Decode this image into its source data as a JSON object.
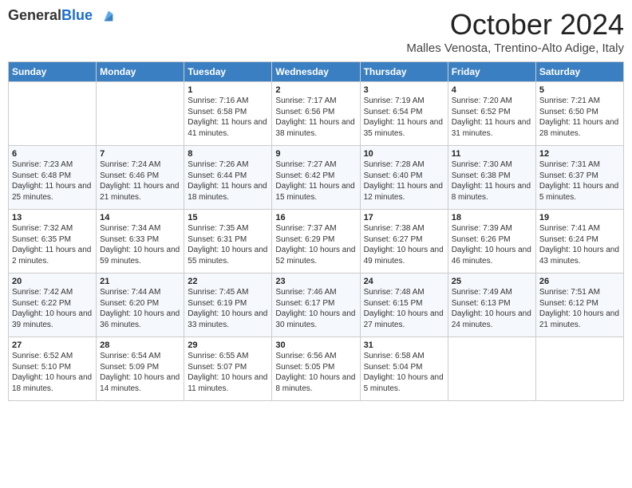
{
  "header": {
    "logo_general": "General",
    "logo_blue": "Blue",
    "month_title": "October 2024",
    "subtitle": "Malles Venosta, Trentino-Alto Adige, Italy"
  },
  "days_of_week": [
    "Sunday",
    "Monday",
    "Tuesday",
    "Wednesday",
    "Thursday",
    "Friday",
    "Saturday"
  ],
  "weeks": [
    [
      {
        "day": "",
        "info": ""
      },
      {
        "day": "",
        "info": ""
      },
      {
        "day": "1",
        "info": "Sunrise: 7:16 AM\nSunset: 6:58 PM\nDaylight: 11 hours and 41 minutes."
      },
      {
        "day": "2",
        "info": "Sunrise: 7:17 AM\nSunset: 6:56 PM\nDaylight: 11 hours and 38 minutes."
      },
      {
        "day": "3",
        "info": "Sunrise: 7:19 AM\nSunset: 6:54 PM\nDaylight: 11 hours and 35 minutes."
      },
      {
        "day": "4",
        "info": "Sunrise: 7:20 AM\nSunset: 6:52 PM\nDaylight: 11 hours and 31 minutes."
      },
      {
        "day": "5",
        "info": "Sunrise: 7:21 AM\nSunset: 6:50 PM\nDaylight: 11 hours and 28 minutes."
      }
    ],
    [
      {
        "day": "6",
        "info": "Sunrise: 7:23 AM\nSunset: 6:48 PM\nDaylight: 11 hours and 25 minutes."
      },
      {
        "day": "7",
        "info": "Sunrise: 7:24 AM\nSunset: 6:46 PM\nDaylight: 11 hours and 21 minutes."
      },
      {
        "day": "8",
        "info": "Sunrise: 7:26 AM\nSunset: 6:44 PM\nDaylight: 11 hours and 18 minutes."
      },
      {
        "day": "9",
        "info": "Sunrise: 7:27 AM\nSunset: 6:42 PM\nDaylight: 11 hours and 15 minutes."
      },
      {
        "day": "10",
        "info": "Sunrise: 7:28 AM\nSunset: 6:40 PM\nDaylight: 11 hours and 12 minutes."
      },
      {
        "day": "11",
        "info": "Sunrise: 7:30 AM\nSunset: 6:38 PM\nDaylight: 11 hours and 8 minutes."
      },
      {
        "day": "12",
        "info": "Sunrise: 7:31 AM\nSunset: 6:37 PM\nDaylight: 11 hours and 5 minutes."
      }
    ],
    [
      {
        "day": "13",
        "info": "Sunrise: 7:32 AM\nSunset: 6:35 PM\nDaylight: 11 hours and 2 minutes."
      },
      {
        "day": "14",
        "info": "Sunrise: 7:34 AM\nSunset: 6:33 PM\nDaylight: 10 hours and 59 minutes."
      },
      {
        "day": "15",
        "info": "Sunrise: 7:35 AM\nSunset: 6:31 PM\nDaylight: 10 hours and 55 minutes."
      },
      {
        "day": "16",
        "info": "Sunrise: 7:37 AM\nSunset: 6:29 PM\nDaylight: 10 hours and 52 minutes."
      },
      {
        "day": "17",
        "info": "Sunrise: 7:38 AM\nSunset: 6:27 PM\nDaylight: 10 hours and 49 minutes."
      },
      {
        "day": "18",
        "info": "Sunrise: 7:39 AM\nSunset: 6:26 PM\nDaylight: 10 hours and 46 minutes."
      },
      {
        "day": "19",
        "info": "Sunrise: 7:41 AM\nSunset: 6:24 PM\nDaylight: 10 hours and 43 minutes."
      }
    ],
    [
      {
        "day": "20",
        "info": "Sunrise: 7:42 AM\nSunset: 6:22 PM\nDaylight: 10 hours and 39 minutes."
      },
      {
        "day": "21",
        "info": "Sunrise: 7:44 AM\nSunset: 6:20 PM\nDaylight: 10 hours and 36 minutes."
      },
      {
        "day": "22",
        "info": "Sunrise: 7:45 AM\nSunset: 6:19 PM\nDaylight: 10 hours and 33 minutes."
      },
      {
        "day": "23",
        "info": "Sunrise: 7:46 AM\nSunset: 6:17 PM\nDaylight: 10 hours and 30 minutes."
      },
      {
        "day": "24",
        "info": "Sunrise: 7:48 AM\nSunset: 6:15 PM\nDaylight: 10 hours and 27 minutes."
      },
      {
        "day": "25",
        "info": "Sunrise: 7:49 AM\nSunset: 6:13 PM\nDaylight: 10 hours and 24 minutes."
      },
      {
        "day": "26",
        "info": "Sunrise: 7:51 AM\nSunset: 6:12 PM\nDaylight: 10 hours and 21 minutes."
      }
    ],
    [
      {
        "day": "27",
        "info": "Sunrise: 6:52 AM\nSunset: 5:10 PM\nDaylight: 10 hours and 18 minutes."
      },
      {
        "day": "28",
        "info": "Sunrise: 6:54 AM\nSunset: 5:09 PM\nDaylight: 10 hours and 14 minutes."
      },
      {
        "day": "29",
        "info": "Sunrise: 6:55 AM\nSunset: 5:07 PM\nDaylight: 10 hours and 11 minutes."
      },
      {
        "day": "30",
        "info": "Sunrise: 6:56 AM\nSunset: 5:05 PM\nDaylight: 10 hours and 8 minutes."
      },
      {
        "day": "31",
        "info": "Sunrise: 6:58 AM\nSunset: 5:04 PM\nDaylight: 10 hours and 5 minutes."
      },
      {
        "day": "",
        "info": ""
      },
      {
        "day": "",
        "info": ""
      }
    ]
  ]
}
